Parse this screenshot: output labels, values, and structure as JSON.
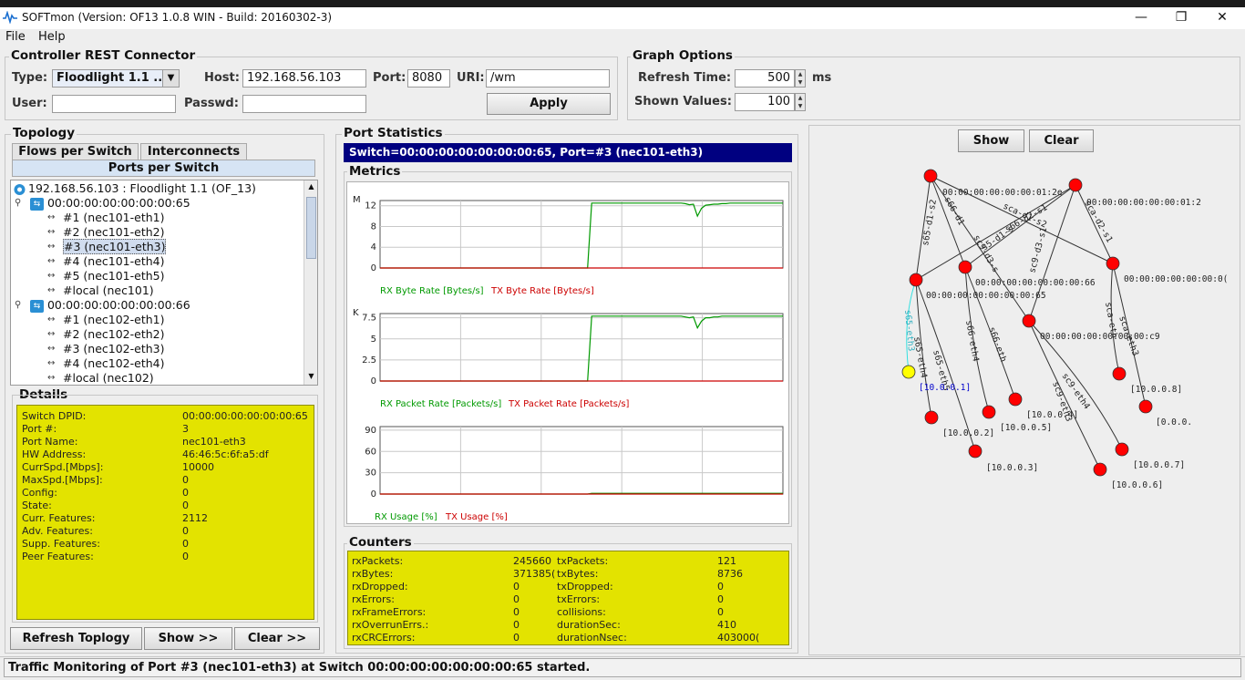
{
  "window": {
    "title": "SOFTmon (Version: OF13 1.0.8 WIN - Build: 20160302-3)",
    "controls": {
      "minimize": "—",
      "maximize": "❐",
      "close": "✕"
    }
  },
  "menu": [
    "File",
    "Help"
  ],
  "controller": {
    "group_label": "Controller REST Connector",
    "type_label": "Type:",
    "type_value": "Floodlight 1.1 ...",
    "host_label": "Host:",
    "host_value": "192.168.56.103",
    "port_label": "Port:",
    "port_value": "8080",
    "uri_label": "URI:",
    "uri_value": "/wm",
    "user_label": "User:",
    "user_value": "",
    "passwd_label": "Passwd:",
    "passwd_value": "",
    "apply_label": "Apply"
  },
  "graph_options": {
    "group_label": "Graph Options",
    "refresh_label": "Refresh Time:",
    "refresh_value": "500",
    "refresh_unit": "ms",
    "shown_label": "Shown Values:",
    "shown_value": "100"
  },
  "topology": {
    "title": "Topology",
    "tabs": [
      "Flows per Switch",
      "Interconnects",
      "Ports per Switch"
    ],
    "tree": [
      {
        "text": "192.168.56.103 : Floodlight 1.1 (OF_13)",
        "level": 0,
        "icon": "controller-icon"
      },
      {
        "text": "00:00:00:00:00:00:00:65",
        "level": 1,
        "icon": "switch-icon"
      },
      {
        "text": "#1 (nec101-eth1)",
        "level": 2,
        "icon": "port-icon"
      },
      {
        "text": "#2 (nec101-eth2)",
        "level": 2,
        "icon": "port-icon"
      },
      {
        "text": "#3 (nec101-eth3)",
        "level": 2,
        "icon": "port-icon",
        "selected": true
      },
      {
        "text": "#4 (nec101-eth4)",
        "level": 2,
        "icon": "port-icon"
      },
      {
        "text": "#5 (nec101-eth5)",
        "level": 2,
        "icon": "port-icon"
      },
      {
        "text": "#local (nec101)",
        "level": 2,
        "icon": "port-icon"
      },
      {
        "text": "00:00:00:00:00:00:00:66",
        "level": 1,
        "icon": "switch-icon"
      },
      {
        "text": "#1 (nec102-eth1)",
        "level": 2,
        "icon": "port-icon"
      },
      {
        "text": "#2 (nec102-eth2)",
        "level": 2,
        "icon": "port-icon"
      },
      {
        "text": "#3 (nec102-eth3)",
        "level": 2,
        "icon": "port-icon"
      },
      {
        "text": "#4 (nec102-eth4)",
        "level": 2,
        "icon": "port-icon"
      },
      {
        "text": "#local (nec102)",
        "level": 2,
        "icon": "port-icon"
      }
    ],
    "details_title": "Details",
    "details": [
      {
        "k": "Switch DPID:",
        "v": "00:00:00:00:00:00:00:65"
      },
      {
        "k": "Port #:",
        "v": "3"
      },
      {
        "k": "Port Name:",
        "v": "nec101-eth3"
      },
      {
        "k": "HW Address:",
        "v": "46:46:5c:6f:a5:df"
      },
      {
        "k": "CurrSpd.[Mbps]:",
        "v": "10000"
      },
      {
        "k": "MaxSpd.[Mbps]:",
        "v": "0"
      },
      {
        "k": "Config:",
        "v": "0"
      },
      {
        "k": "State:",
        "v": "0"
      },
      {
        "k": "Curr. Features:",
        "v": "2112"
      },
      {
        "k": "Adv. Features:",
        "v": "0"
      },
      {
        "k": "Supp. Features:",
        "v": "0"
      },
      {
        "k": "Peer Features:",
        "v": "0"
      }
    ],
    "buttons": [
      "Refresh Toplogy",
      "Show >>",
      "Clear >>"
    ]
  },
  "port_stats": {
    "title": "Port Statistics",
    "header": "Switch=00:00:00:00:00:00:00:65, Port=#3 (nec101-eth3)",
    "metrics_title": "Metrics",
    "counters_title": "Counters",
    "counters_left": [
      {
        "k": "rxPackets:",
        "v": "245660"
      },
      {
        "k": "rxBytes:",
        "v": "371385("
      },
      {
        "k": "rxDropped:",
        "v": "0"
      },
      {
        "k": "rxErrors:",
        "v": "0"
      },
      {
        "k": "rxFrameErrors:",
        "v": "0"
      },
      {
        "k": "rxOverrunErrs.:",
        "v": "0"
      },
      {
        "k": "rxCRCErrors:",
        "v": "0"
      }
    ],
    "counters_right": [
      {
        "k": "txPackets:",
        "v": "121"
      },
      {
        "k": "txBytes:",
        "v": "8736"
      },
      {
        "k": "txDropped:",
        "v": "0"
      },
      {
        "k": "txErrors:",
        "v": "0"
      },
      {
        "k": "collisions:",
        "v": "0"
      },
      {
        "k": "durationSec:",
        "v": "410"
      },
      {
        "k": "durationNsec:",
        "v": "403000("
      }
    ],
    "colors": {
      "rx": "#009900",
      "tx": "#cc0000",
      "header_bg": "#000080",
      "counters_bg": "#e3e300"
    }
  },
  "chart_data": [
    {
      "type": "line",
      "unit_label": "M",
      "ylim": [
        0,
        13
      ],
      "yticks": [
        "0",
        "4",
        "8",
        "12"
      ],
      "series": [
        {
          "name": "RX Byte Rate [Bytes/s]",
          "values": [
            0,
            0,
            0,
            0,
            0,
            0,
            0,
            0,
            0,
            0,
            0,
            0,
            0,
            0,
            0,
            0,
            0,
            0,
            0,
            0,
            0,
            0,
            0,
            0,
            0,
            0,
            0,
            0,
            0,
            0,
            0,
            0,
            0,
            0,
            0,
            0,
            0,
            0,
            0,
            0,
            0,
            0,
            0,
            0,
            0,
            0,
            0,
            0,
            0,
            0,
            0,
            0,
            12.5,
            12.5,
            12.5,
            12.5,
            12.5,
            12.5,
            12.5,
            12.5,
            12.5,
            12.5,
            12.5,
            12.5,
            12.5,
            12.5,
            12.5,
            12.5,
            12.5,
            12.5,
            12.5,
            12.5,
            12.5,
            12.5,
            12.5,
            12.4,
            12.2,
            12.3,
            10,
            11.5,
            12.1,
            12.2,
            12.3,
            12.3,
            12.4,
            12.4,
            12.5,
            12.5,
            12.5,
            12.5,
            12.5,
            12.5,
            12.5,
            12.5,
            12.5,
            12.5,
            12.5,
            12.5,
            12.5,
            12.5
          ]
        },
        {
          "name": "TX Byte Rate [Bytes/s]",
          "values": [
            0
          ]
        }
      ]
    },
    {
      "type": "line",
      "unit_label": "K",
      "ylim": [
        0,
        8
      ],
      "yticks": [
        "0",
        "2.5",
        "5",
        "7.5"
      ],
      "series": [
        {
          "name": "RX Packet Rate [Packets/s]",
          "values": [
            0,
            0,
            0,
            0,
            0,
            0,
            0,
            0,
            0,
            0,
            0,
            0,
            0,
            0,
            0,
            0,
            0,
            0,
            0,
            0,
            0,
            0,
            0,
            0,
            0,
            0,
            0,
            0,
            0,
            0,
            0,
            0,
            0,
            0,
            0,
            0,
            0,
            0,
            0,
            0,
            0,
            0,
            0,
            0,
            0,
            0,
            0,
            0,
            0,
            0,
            0,
            0,
            7.7,
            7.7,
            7.7,
            7.7,
            7.7,
            7.7,
            7.7,
            7.7,
            7.7,
            7.7,
            7.7,
            7.7,
            7.7,
            7.7,
            7.7,
            7.7,
            7.7,
            7.7,
            7.7,
            7.7,
            7.7,
            7.7,
            7.7,
            7.6,
            7.5,
            7.6,
            6.3,
            7.1,
            7.5,
            7.5,
            7.6,
            7.6,
            7.7,
            7.7,
            7.7,
            7.7,
            7.7,
            7.7,
            7.7,
            7.7,
            7.7,
            7.7,
            7.7,
            7.7,
            7.7,
            7.7,
            7.7,
            7.7
          ]
        },
        {
          "name": "TX Packet Rate [Packets/s]",
          "values": [
            0
          ]
        }
      ]
    },
    {
      "type": "line",
      "unit_label": "",
      "ylim": [
        0,
        95
      ],
      "yticks": [
        "0",
        "30",
        "60",
        "90"
      ],
      "series": [
        {
          "name": "RX Usage [%]",
          "values": [
            0,
            0,
            0,
            0,
            0,
            0,
            0,
            0,
            0,
            0,
            0,
            0,
            0,
            0,
            0,
            0,
            0,
            0,
            0,
            0,
            0,
            0,
            0,
            0,
            0,
            0,
            0,
            0,
            0,
            0,
            0,
            0,
            0,
            0,
            0,
            0,
            0,
            0,
            0,
            0,
            0,
            0,
            0,
            0,
            0,
            0,
            0,
            0,
            0,
            0,
            0,
            0,
            1,
            1,
            1,
            1,
            1,
            1,
            1,
            1,
            1,
            1,
            1,
            1,
            1,
            1,
            1,
            1,
            1,
            1,
            1,
            1,
            1,
            1,
            1,
            1,
            1,
            1,
            1,
            1,
            1,
            1,
            1,
            1,
            1,
            1,
            1,
            1,
            1,
            1,
            1,
            1,
            1,
            1,
            1,
            1,
            1,
            1,
            1,
            1
          ]
        },
        {
          "name": "TX Usage [%]",
          "values": [
            0
          ]
        }
      ]
    }
  ],
  "graph_view": {
    "show_label": "Show",
    "clear_label": "Clear",
    "node_labels": [
      "00:00:00:00:00:00:01:2e",
      "00:00:00:00:00:00:01:2",
      "00:00:00:00:00:00:00:65",
      "00:00:00:00:00:00:00:66",
      "00:00:00:00:00:00:00:c9",
      "00:00:00:00:00:00:0(",
      "[10.0.0.1]",
      "[10.0.0.2]",
      "[10.0.0.3]",
      "[10.0.0.4]",
      "[10.0.0.5]",
      "[10.0.0.6]",
      "[10.0.0.7]",
      "[10.0.0.8]",
      "[0.0.0."
    ],
    "edge_labels": [
      "s65-d1-s2",
      "s66-d1",
      "sca-d1-s2",
      "s66-d2-s1",
      "sc9-d3-s1",
      "sca-d2-s1",
      "s5-d1-s",
      "sc9-d3-s",
      "s65-eth4",
      "s65-eth5",
      "s66-eth4",
      "s66-eth",
      "sc9-eth4",
      "sc9-eth3",
      "sca-eth",
      "sca-eth3",
      "s65-eth3"
    ],
    "colors": {
      "switch": "#ff0000",
      "host": "#ffff00",
      "link": "#333333",
      "active_link": "#33e0e0"
    }
  },
  "status": "Traffic Monitoring of Port #3 (nec101-eth3) at Switch 00:00:00:00:00:00:00:65 started."
}
